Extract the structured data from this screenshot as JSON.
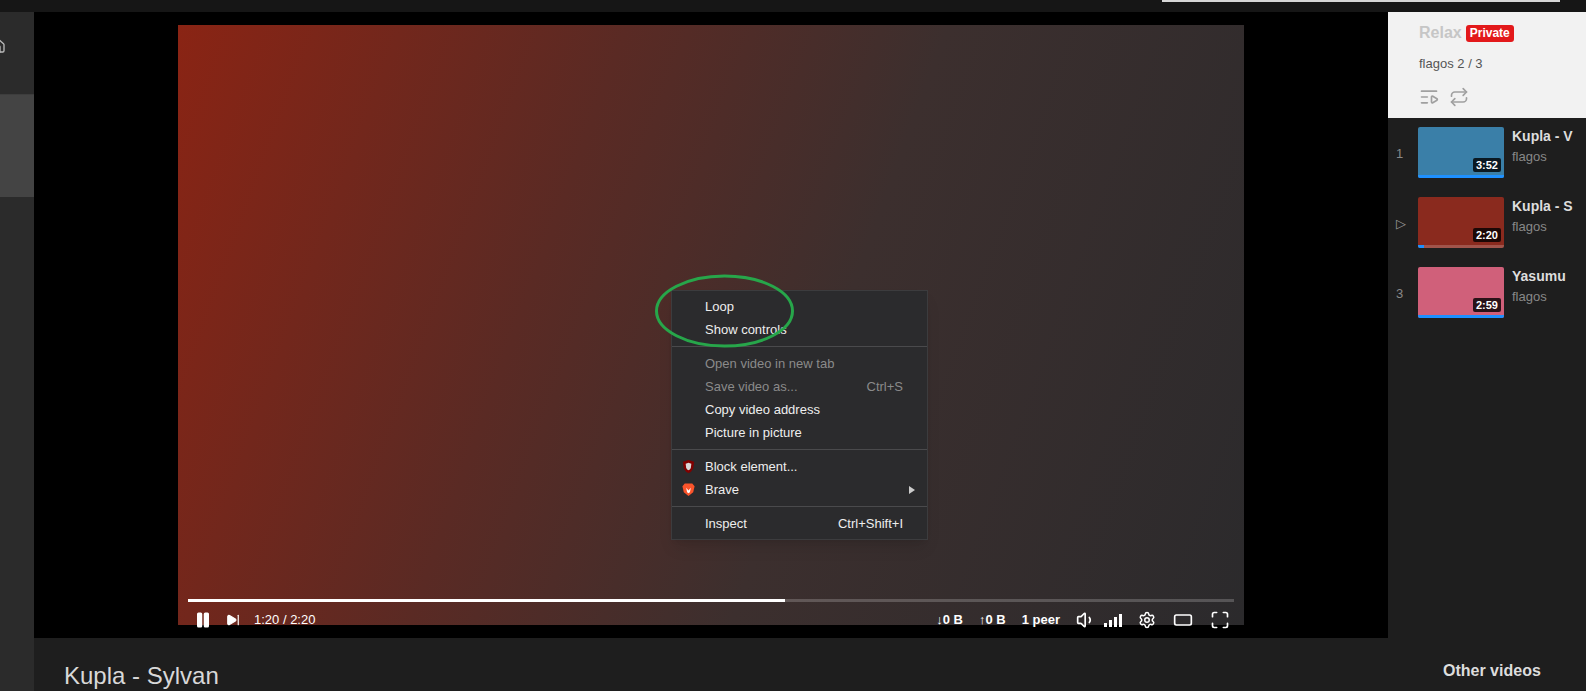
{
  "player": {
    "playing": true,
    "level": 0.571,
    "time": "1:20 / 2:20",
    "download": "↓0 B",
    "upload": "↑0 B",
    "peers": "1 peer",
    "volume_level": 1
  },
  "context_menu": {
    "sections": [
      [
        {
          "label": "Loop",
          "disabled": false,
          "kind": "plain",
          "submenu": false
        },
        {
          "label": "Show controls",
          "disabled": false,
          "kind": "plain",
          "submenu": false
        }
      ],
      [
        {
          "label": "Open video in new tab",
          "disabled": true,
          "kind": "plain",
          "submenu": false
        },
        {
          "label": "Save video as...",
          "shortcut": "Ctrl+S",
          "disabled": true,
          "kind": "plain",
          "submenu": false
        },
        {
          "label": "Copy video address",
          "disabled": false,
          "kind": "plain",
          "submenu": false
        },
        {
          "label": "Picture in picture",
          "disabled": false,
          "kind": "plain",
          "submenu": false
        }
      ],
      [
        {
          "label": "Block element...",
          "disabled": false,
          "kind": "ublock",
          "submenu": false
        },
        {
          "label": "Brave",
          "disabled": false,
          "kind": "brave",
          "submenu": true
        }
      ],
      [
        {
          "label": "Inspect",
          "shortcut": "Ctrl+Shift+I",
          "disabled": false,
          "kind": "plain",
          "submenu": false
        }
      ]
    ]
  },
  "playlist": {
    "name": "Relax",
    "name_disabled": true,
    "badge": "Private",
    "owner_position": "flagos 2 / 3",
    "items": [
      {
        "marker": "1",
        "duration": "3:52",
        "title": "Kupla - V",
        "channel": "flagos",
        "selected": false,
        "watched_level": 1,
        "color": "#3a7fa8"
      },
      {
        "marker": "▷",
        "duration": "2:20",
        "title": "Kupla - S",
        "channel": "flagos",
        "selected": true,
        "watched_level": 0.07,
        "color": "#8a2a1e"
      },
      {
        "marker": "3",
        "duration": "2:59",
        "title": "Yasumu",
        "channel": "flagos",
        "selected": false,
        "watched_level": 1,
        "color": "#d0607a"
      }
    ]
  },
  "video": {
    "title": "Kupla - Sylvan"
  },
  "other_videos": {
    "heading": "Other videos"
  }
}
